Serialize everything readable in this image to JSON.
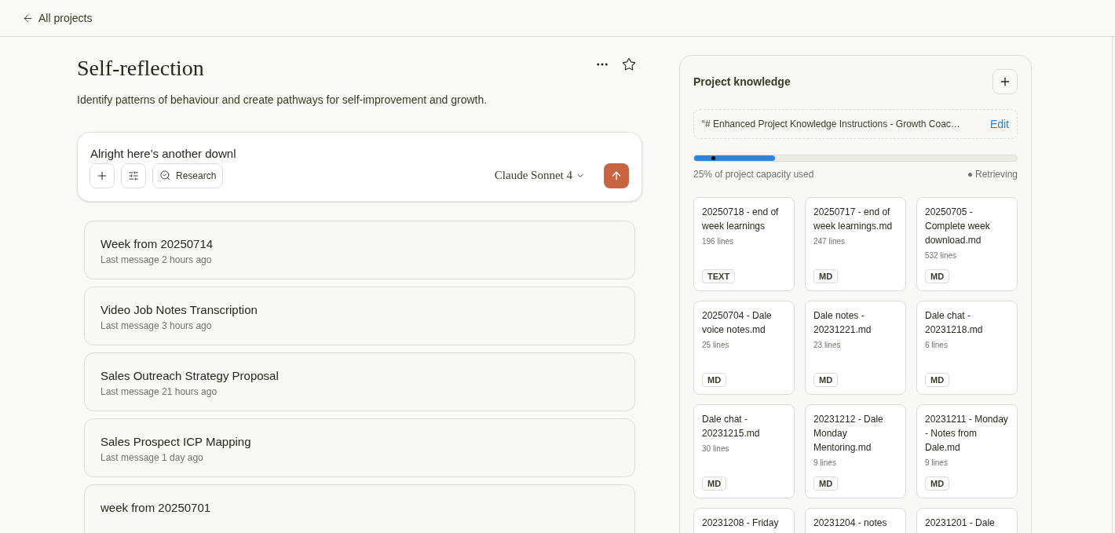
{
  "nav": {
    "back_label": "All projects"
  },
  "project": {
    "title": "Self-reflection",
    "description": "Identify patterns of behaviour and create pathways for self-improvement and growth."
  },
  "composer": {
    "value": "Alright here's another downl",
    "research_label": "Research",
    "model": "Claude Sonnet 4"
  },
  "chats": [
    {
      "title": "Week from 20250714",
      "meta": "Last message 2 hours ago"
    },
    {
      "title": "Video Job Notes Transcription",
      "meta": "Last message 3 hours ago"
    },
    {
      "title": "Sales Outreach Strategy Proposal",
      "meta": "Last message 21 hours ago"
    },
    {
      "title": "Sales Prospect ICP Mapping",
      "meta": "Last message 1 day ago"
    },
    {
      "title": "week from 20250701"
    }
  ],
  "knowledge": {
    "title": "Project knowledge",
    "instructions": "“# Enhanced Project Knowledge Instructions - Growth Coac…",
    "edit_label": "Edit",
    "capacity": {
      "level": 0.25,
      "label": "25% of project capacity used",
      "status": "Retrieving"
    },
    "files": [
      {
        "name": "20250718 - end of week learnings",
        "lines": "196 lines",
        "type": "TEXT"
      },
      {
        "name": "20250717 - end of week learnings.md",
        "lines": "247 lines",
        "type": "MD"
      },
      {
        "name": "20250705 - Complete week download.md",
        "lines": "532 lines",
        "type": "MD"
      },
      {
        "name": "20250704 - Dale voice notes.md",
        "lines": "25 lines",
        "type": "MD"
      },
      {
        "name": "Dale notes - 20231221.md",
        "lines": "23 lines",
        "type": "MD"
      },
      {
        "name": "Dale chat - 20231218.md",
        "lines": "6 lines",
        "type": "MD"
      },
      {
        "name": "Dale chat - 20231215.md",
        "lines": "30 lines",
        "type": "MD"
      },
      {
        "name": "20231212 - Dale Monday Mentoring.md",
        "lines": "9 lines",
        "type": "MD"
      },
      {
        "name": "20231211 - Monday - Notes from Dale.md",
        "lines": "9 lines",
        "type": "MD"
      },
      {
        "name": "20231208 - Friday"
      },
      {
        "name": "20231204 - notes"
      },
      {
        "name": "20231201 - Dale"
      }
    ]
  }
}
